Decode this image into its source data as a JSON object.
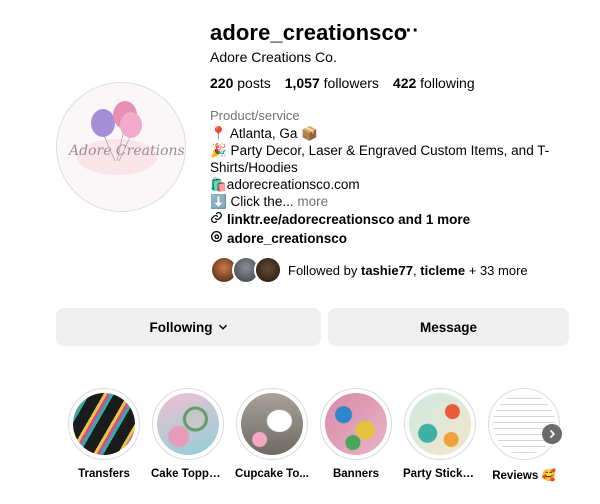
{
  "profile": {
    "username": "adore_creationsco",
    "full_name": "Adore Creations Co.",
    "more_icon": "ellipsis-icon",
    "avatar_text": "Adore Creations",
    "stats": {
      "posts_count": "220",
      "posts_label": "posts",
      "followers_count": "1,057",
      "followers_label": "followers",
      "following_count": "422",
      "following_label": "following"
    },
    "category": "Product/service",
    "bio": {
      "line1": "📍 Atlanta, Ga 📦",
      "line2": "🎉 Party Decor, Laser & Engraved Custom Items, and T-",
      "line3": "Shirts/Hoodies",
      "line4": "🛍️adorecreationsco.com",
      "line5": "⬇️ Click the...",
      "more": "more"
    },
    "link_text": "linktr.ee/adorecreationsco and 1 more",
    "threads_handle": "adore_creationsco",
    "followed_by": {
      "prefix": "Followed by",
      "user1": "tashie77",
      "sep": ",",
      "user2": "ticleme",
      "suffix": "+ 33 more"
    }
  },
  "actions": {
    "following_label": "Following",
    "message_label": "Message"
  },
  "highlights": [
    {
      "label": "Transfers"
    },
    {
      "label": "Cake Toppers"
    },
    {
      "label": "Cupcake To..."
    },
    {
      "label": "Banners"
    },
    {
      "label": "Party Stickers"
    },
    {
      "label": "Reviews 🥰"
    }
  ],
  "colors": {
    "button_bg": "#efefef",
    "secondary_text": "#737373",
    "border": "#dbdbdb"
  }
}
